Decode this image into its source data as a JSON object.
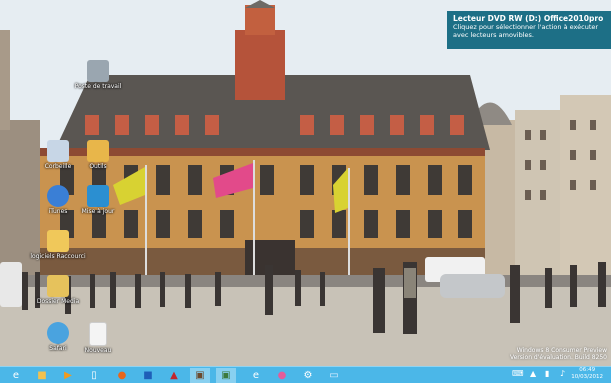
{
  "notification": {
    "title": "Lecteur DVD RW (D:) Office2010pro",
    "body": "Cliquez pour sélectionner l'action à exécuter avec lecteurs amovibles."
  },
  "desktop_icons": [
    {
      "label": "Poste de travail",
      "icon": "computer-icon",
      "color": "#9aa6b0"
    },
    {
      "label": "Corbeille",
      "icon": "recycle-bin-icon",
      "color": "#c7d6e6"
    },
    {
      "label": "Outils",
      "icon": "folder-icon",
      "color": "#e8b64a"
    },
    {
      "label": "iTunes",
      "icon": "itunes-icon",
      "color": "#3a7fd6"
    },
    {
      "label": "Mise à jour",
      "icon": "update-icon",
      "color": "#2b8fd1"
    },
    {
      "label": "logiciels Raccourci",
      "icon": "software-folder-icon",
      "color": "#f0c85a"
    },
    {
      "label": "Dossier Media",
      "icon": "media-folder-icon",
      "color": "#e6c25c"
    },
    {
      "label": "Safari",
      "icon": "safari-icon",
      "color": "#4aa3df"
    },
    {
      "label": "Nouveau",
      "icon": "document-icon",
      "color": "#f4f4f4"
    }
  ],
  "watermark": {
    "line1": "Windows 8 Consumer Preview",
    "line2": "Version d'évaluation. Build 8250"
  },
  "taskbar": {
    "apps": [
      "internet-explorer-icon",
      "file-explorer-icon",
      "media-player-icon",
      "documents-icon",
      "firefox-icon",
      "outlook-icon",
      "acrobat-icon",
      "photo-icon",
      "desktop-app-icon",
      "ie-alt-icon",
      "paint-icon",
      "tools-icon",
      "computer-app-icon"
    ],
    "time": "06:49",
    "date": "10/03/2012"
  }
}
